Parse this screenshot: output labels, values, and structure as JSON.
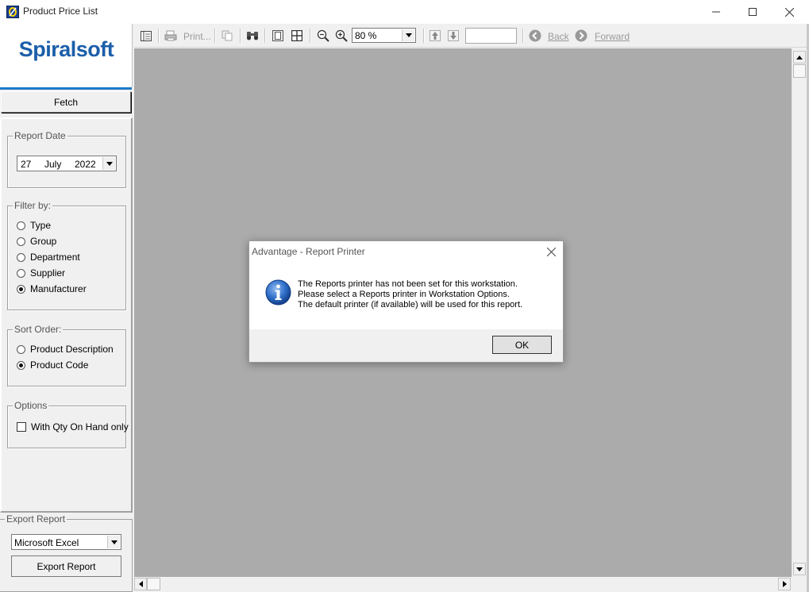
{
  "window": {
    "title": "Product Price List"
  },
  "logo": {
    "text": "Spiralsoft"
  },
  "left_panel": {
    "fetch_label": "Fetch",
    "report_date": {
      "legend": "Report Date",
      "day": "27",
      "month": "July",
      "year": "2022"
    },
    "filter_by": {
      "legend": "Filter by:",
      "options": [
        "Type",
        "Group",
        "Department",
        "Supplier",
        "Manufacturer"
      ],
      "selected": "Manufacturer"
    },
    "sort_order": {
      "legend": "Sort Order:",
      "options": [
        "Product Description",
        "Product Code"
      ],
      "selected": "Product Code"
    },
    "options_group": {
      "legend": "Options",
      "qty_on_hand_label": "With Qty On Hand only",
      "qty_on_hand_checked": false
    },
    "export": {
      "legend": "Export Report",
      "format": "Microsoft Excel",
      "button_label": "Export Report"
    }
  },
  "toolbar": {
    "print_label": "Print...",
    "zoom_value": "80 %",
    "page_value": "",
    "back_label": "Back",
    "forward_label": "Forward"
  },
  "dialog": {
    "title": "Advantage - Report Printer",
    "message_lines": [
      "The Reports printer has not been set for this workstation.",
      "Please select a Reports printer in Workstation Options.",
      "The default printer (if available) will be used for this report."
    ],
    "ok_label": "OK"
  },
  "icons": {
    "app": "app-logo-icon",
    "info": "information-icon"
  },
  "colors": {
    "brand_blue": "#1b5ea9",
    "accent_bar": "#1b7ac9",
    "preview_background": "#ababab",
    "info_blue": "#2f6fca"
  }
}
